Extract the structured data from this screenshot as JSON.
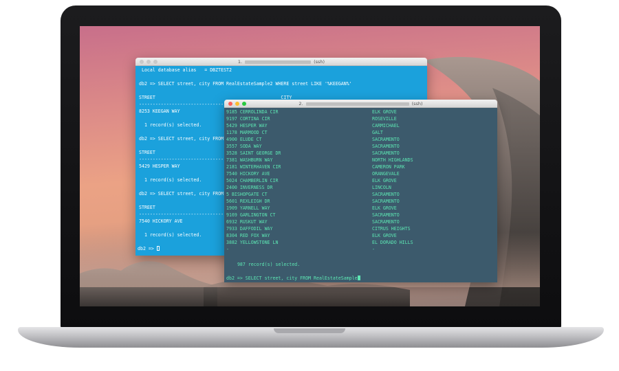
{
  "term1": {
    "title_num": "1.",
    "title_suffix": "(ssh)",
    "lines": {
      "alias": " Local database alias   = DBZTEST2",
      "q1": "db2 => SELECT street, city FROM RealEstateSample2 WHERE street LIKE '%KEEGAN%'",
      "h1": "STREET                                              CITY",
      "d1": "--------------------------------------------------- ",
      "r1": "8253 KEEGAN WAY",
      "c1": "  1 record(s) selected.",
      "q2": "db2 => SELECT street, city FROM R",
      "h2": "STREET",
      "d2": "------------------------------------------",
      "r2": "5429 HESPER WAY",
      "c2": "  1 record(s) selected.",
      "q3": "db2 => SELECT street, city FROM R",
      "h3": "STREET",
      "d3": "------------------------------------------",
      "r3": "7540 HICKORY AVE",
      "c3": "  1 record(s) selected.",
      "prompt": "db2 => "
    }
  },
  "term2": {
    "title_num": "2.",
    "title_suffix": "(ssh)",
    "rows": [
      {
        "street": "9185 CERROLINDA CIR",
        "city": "ELK GROVE"
      },
      {
        "street": "9197 CORTINA CIR",
        "city": "ROSEVILLE"
      },
      {
        "street": "5429 HESPER WAY",
        "city": "CARMICHAEL"
      },
      {
        "street": "1178 MARMOOD CT",
        "city": "GALT"
      },
      {
        "street": "4900 ELUDE CT",
        "city": "SACRAMENTO"
      },
      {
        "street": "3557 SODA WAY",
        "city": "SACRAMENTO"
      },
      {
        "street": "3528 SAINT GEORGE DR",
        "city": "SACRAMENTO"
      },
      {
        "street": "7381 WASHBURN WAY",
        "city": "NORTH HIGHLANDS"
      },
      {
        "street": "2181 WINTERHAVEN CIR",
        "city": "CAMERON PARK"
      },
      {
        "street": "7540 HICKORY AVE",
        "city": "ORANGEVALE"
      },
      {
        "street": "5024 CHAMBERLIN CIR",
        "city": "ELK GROVE"
      },
      {
        "street": "2400 INVERNESS DR",
        "city": "LINCOLN"
      },
      {
        "street": "5 BISHOPGATE CT",
        "city": "SACRAMENTO"
      },
      {
        "street": "5601 REXLEIGH DR",
        "city": "SACRAMENTO"
      },
      {
        "street": "1909 YARNELL WAY",
        "city": "ELK GROVE"
      },
      {
        "street": "9169 GARLINGTON CT",
        "city": "SACRAMENTO"
      },
      {
        "street": "6932 RUSKUT WAY",
        "city": "SACRAMENTO"
      },
      {
        "street": "7933 DAFFODIL WAY",
        "city": "CITRUS HEIGHTS"
      },
      {
        "street": "8304 RED FOX WAY",
        "city": "ELK GROVE"
      },
      {
        "street": "3882 YELLOWSTONE LN",
        "city": "EL DORADO HILLS"
      },
      {
        "street": "-",
        "city": "-"
      }
    ],
    "count": "  987 record(s) selected.",
    "prompt": "db2 => SELECT street, city FROM RealEstateSample"
  }
}
